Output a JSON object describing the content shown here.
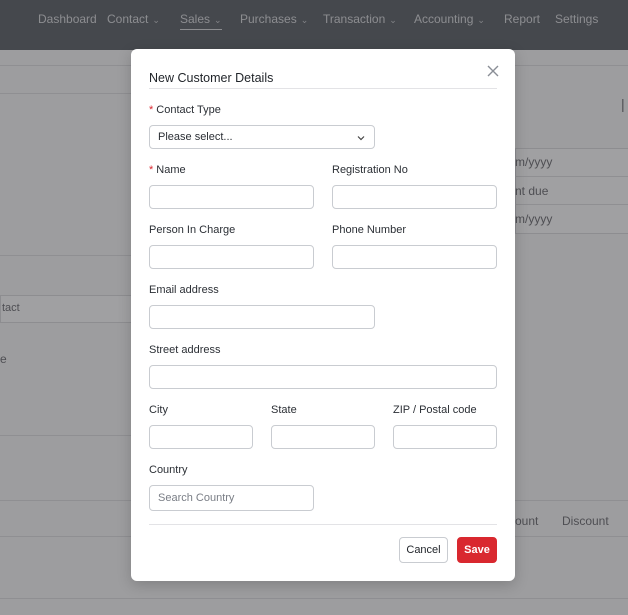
{
  "nav": {
    "items": [
      {
        "label": "Dashboard",
        "dropdown": false
      },
      {
        "label": "Contact",
        "dropdown": true
      },
      {
        "label": "Sales",
        "dropdown": true,
        "active": true
      },
      {
        "label": "Purchases",
        "dropdown": true
      },
      {
        "label": "Transaction",
        "dropdown": true
      },
      {
        "label": "Accounting",
        "dropdown": true
      },
      {
        "label": "Report",
        "dropdown": false
      },
      {
        "label": "Settings",
        "dropdown": false
      }
    ]
  },
  "background": {
    "date_placeholder_1": "m/yyyy",
    "payment_due": "nt due",
    "date_placeholder_2": "m/yyyy",
    "contact_fragment": "tact",
    "discount_fragment": "ount",
    "discount_label": "Discount",
    "fragment_e": "e"
  },
  "modal": {
    "title": "New Customer Details",
    "contact_type": {
      "label": "Contact Type",
      "required": "*",
      "value": "Please select..."
    },
    "name": {
      "label": "Name",
      "required": "*",
      "value": ""
    },
    "registration_no": {
      "label": "Registration No",
      "value": ""
    },
    "person_in_charge": {
      "label": "Person In Charge",
      "value": ""
    },
    "phone_number": {
      "label": "Phone Number",
      "value": ""
    },
    "email": {
      "label": "Email address",
      "value": ""
    },
    "street": {
      "label": "Street address",
      "value": ""
    },
    "city": {
      "label": "City",
      "value": ""
    },
    "state": {
      "label": "State",
      "value": ""
    },
    "zip": {
      "label": "ZIP / Postal code",
      "value": ""
    },
    "country": {
      "label": "Country",
      "placeholder": "Search Country",
      "value": ""
    },
    "cancel_label": "Cancel",
    "save_label": "Save"
  },
  "colors": {
    "accent": "#d9282f",
    "nav_bg": "#5b5f67"
  },
  "icons": {
    "close": "close-icon",
    "chevron": "chevron-down-icon"
  }
}
